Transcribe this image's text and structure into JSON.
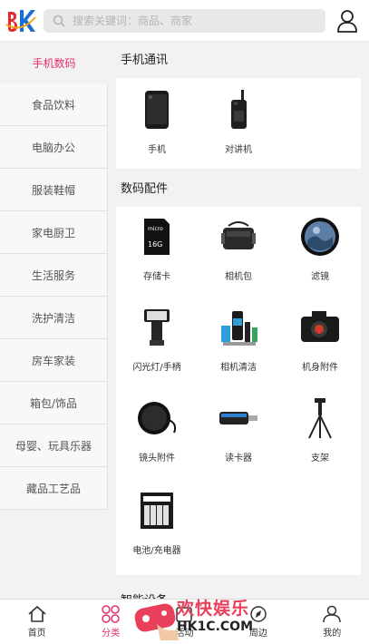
{
  "header": {
    "logo_text": "BK",
    "search_placeholder": "搜索关键词：商品、商家",
    "icons": {
      "search": "search-icon",
      "user": "user-icon"
    }
  },
  "sidebar": {
    "items": [
      {
        "label": "手机数码",
        "active": true
      },
      {
        "label": "食品饮料"
      },
      {
        "label": "电脑办公"
      },
      {
        "label": "服装鞋帽"
      },
      {
        "label": "家电厨卫"
      },
      {
        "label": "生活服务"
      },
      {
        "label": "洗护清洁"
      },
      {
        "label": "房车家装"
      },
      {
        "label": "箱包/饰品"
      },
      {
        "label": "母婴、玩具乐器"
      },
      {
        "label": "藏品工艺品"
      }
    ]
  },
  "main": {
    "sections": [
      {
        "title": "手机通讯",
        "items": [
          {
            "label": "手机",
            "icon": "smartphone-icon"
          },
          {
            "label": "对讲机",
            "icon": "walkie-talkie-icon"
          }
        ]
      },
      {
        "title": "数码配件",
        "items": [
          {
            "label": "存储卡",
            "icon": "sd-card-icon"
          },
          {
            "label": "相机包",
            "icon": "camera-bag-icon"
          },
          {
            "label": "滤镜",
            "icon": "lens-filter-icon"
          },
          {
            "label": "闪光灯/手柄",
            "icon": "flash-icon"
          },
          {
            "label": "相机清洁",
            "icon": "camera-cleaning-icon"
          },
          {
            "label": "机身附件",
            "icon": "camera-body-icon"
          },
          {
            "label": "镜头附件",
            "icon": "lens-cap-icon"
          },
          {
            "label": "读卡器",
            "icon": "card-reader-icon"
          },
          {
            "label": "支架",
            "icon": "tripod-icon"
          },
          {
            "label": "电池/充电器",
            "icon": "battery-icon"
          }
        ]
      },
      {
        "title": "智能设备",
        "items": []
      }
    ]
  },
  "bottom_nav": {
    "tabs": [
      {
        "label": "首页",
        "icon": "home-icon"
      },
      {
        "label": "分类",
        "icon": "category-icon",
        "active": true
      },
      {
        "label": "活动",
        "icon": "activity-icon"
      },
      {
        "label": "周边",
        "icon": "nearby-icon"
      },
      {
        "label": "我的",
        "icon": "profile-icon"
      }
    ]
  },
  "watermark": {
    "title": "欢快娱乐",
    "site": "HK1C.COM"
  },
  "colors": {
    "accent": "#e5306a",
    "logo_red": "#e3262f",
    "logo_blue": "#1a6fd1"
  }
}
